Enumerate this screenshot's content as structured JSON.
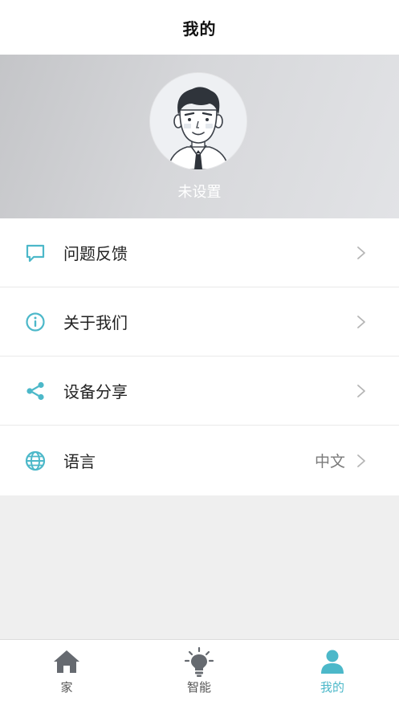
{
  "header": {
    "title": "我的"
  },
  "profile": {
    "avatar_icon": "user-avatar-illustration",
    "username": "未设置"
  },
  "menu": {
    "accent_color": "#4cb8c9",
    "items": [
      {
        "icon": "feedback-icon",
        "label": "问题反馈",
        "value": ""
      },
      {
        "icon": "info-icon",
        "label": "关于我们",
        "value": ""
      },
      {
        "icon": "share-icon",
        "label": "设备分享",
        "value": ""
      },
      {
        "icon": "globe-icon",
        "label": "语言",
        "value": "中文"
      }
    ]
  },
  "tabbar": {
    "active_color": "#4cb8c9",
    "inactive_color": "#555555",
    "tabs": [
      {
        "icon": "home-icon",
        "label": "家",
        "active": false
      },
      {
        "icon": "lightbulb-icon",
        "label": "智能",
        "active": false
      },
      {
        "icon": "person-icon",
        "label": "我的",
        "active": true
      }
    ]
  }
}
